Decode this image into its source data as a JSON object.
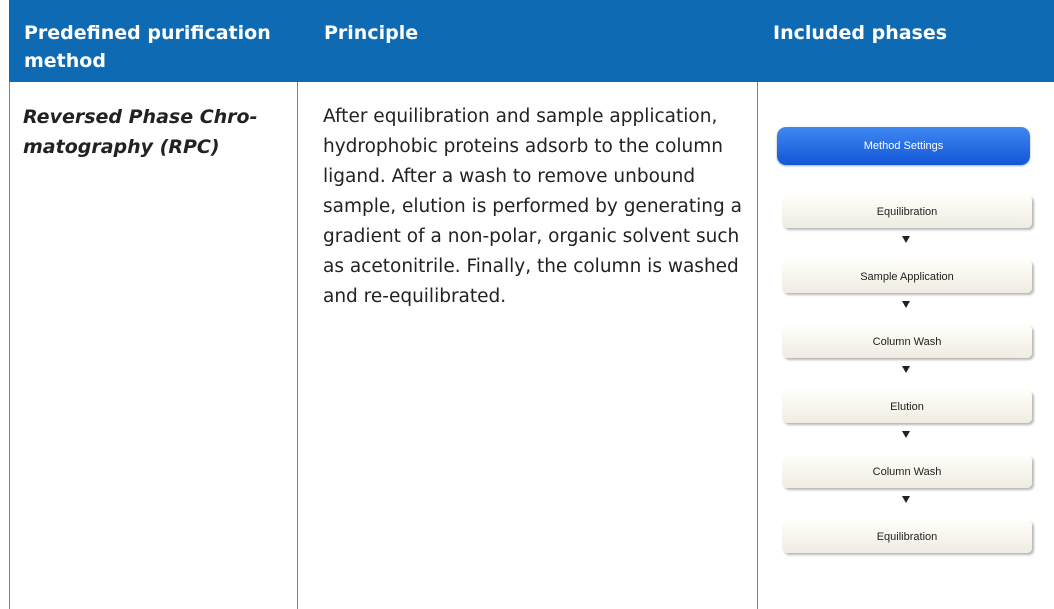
{
  "table": {
    "headers": {
      "method": "Predefined purification method",
      "principle": "Principle",
      "phases": "Included phases"
    },
    "rows": [
      {
        "method": "Reversed Phase Chro-matography (RPC)",
        "principle": "After equilibration and sample application, hydrophobic proteins adsorb to the column ligand. After a wash to remove unbound sample, elution is performed by generating a gradient of a non-polar, organic solvent such as acetonitrile. Finally, the column is washed and re-equilibrated.",
        "method_settings": "Method Settings",
        "phases": [
          "Equilibration",
          "Sample Application",
          "Column Wash",
          "Elution",
          "Column Wash",
          "Equilibration"
        ]
      }
    ]
  },
  "colors": {
    "header_bg": "#0e6bb3",
    "border": "#4a8fd1",
    "method_settings_button": "#2a6fe6"
  },
  "icons": {
    "flow_arrow": "down-triangle"
  }
}
